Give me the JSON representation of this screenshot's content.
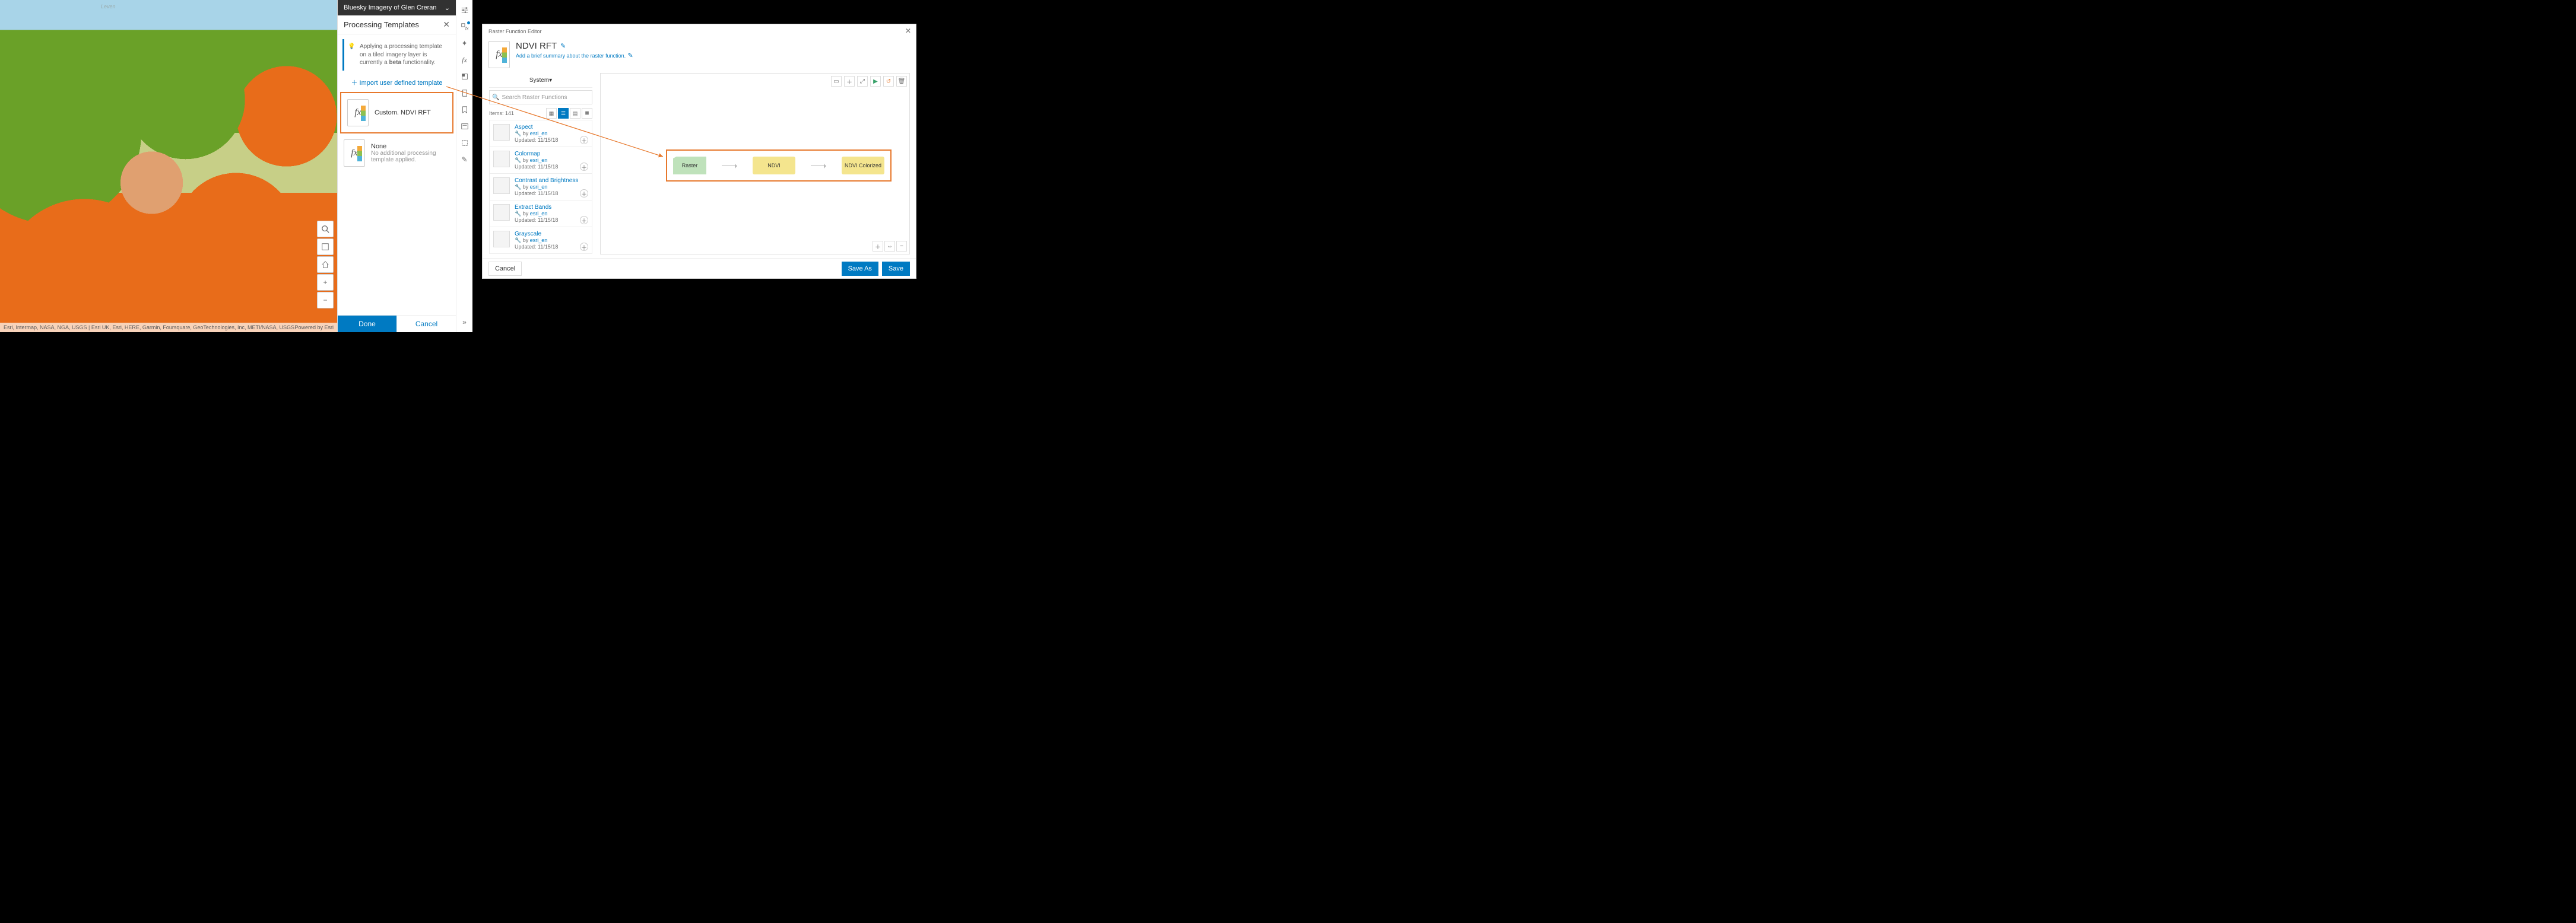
{
  "map": {
    "place_label": "Leven",
    "attribution": "Esri, Intermap, NASA, NGA, USGS | Esri UK, Esri, HERE, Garmin, Foursquare, GeoTechnologies, Inc, METI/NASA, USGS",
    "powered": "Powered by Esri"
  },
  "layer_header": {
    "title": "Bluesky Imagery of Glen Creran"
  },
  "panel": {
    "title": "Processing Templates",
    "info": "Applying a processing template on a tiled imagery layer is currently a beta functionality.",
    "info_bold": "beta",
    "import_link": "Import user defined template",
    "templates": [
      {
        "label": "Custom. NDVI RFT",
        "sub": ""
      },
      {
        "label": "None",
        "sub": "No additional processing template applied."
      }
    ],
    "done": "Done",
    "cancel": "Cancel"
  },
  "rail_icons": [
    "properties",
    "filter-fx",
    "sparkle",
    "fx",
    "swatch",
    "effects",
    "bookmark",
    "text",
    "select",
    "pencil"
  ],
  "editor": {
    "toolbar_label": "Raster Function Editor",
    "title": "NDVI RFT",
    "subtitle": "Add a brief summary about the raster function.",
    "system": "System",
    "search_placeholder": "Search Raster Functions",
    "item_count": "Items: 141",
    "functions": [
      {
        "name": "Aspect",
        "by": "esri_en",
        "updated": "11/15/18",
        "thumb": "t-aspect"
      },
      {
        "name": "Colormap",
        "by": "esri_en",
        "updated": "11/15/18",
        "thumb": "t-colormap"
      },
      {
        "name": "Contrast and Brightness",
        "by": "esri_en",
        "updated": "11/15/18",
        "thumb": "t-contrast"
      },
      {
        "name": "Extract Bands",
        "by": "esri_en",
        "updated": "11/15/18",
        "thumb": "t-bands"
      },
      {
        "name": "Grayscale",
        "by": "esri_en",
        "updated": "11/15/18",
        "thumb": "t-gray"
      }
    ],
    "by_prefix": "by",
    "updated_prefix": "Updated:",
    "nodes": [
      "Raster",
      "NDVI",
      "NDVI Colorized"
    ],
    "cancel": "Cancel",
    "save_as": "Save As",
    "save": "Save"
  }
}
